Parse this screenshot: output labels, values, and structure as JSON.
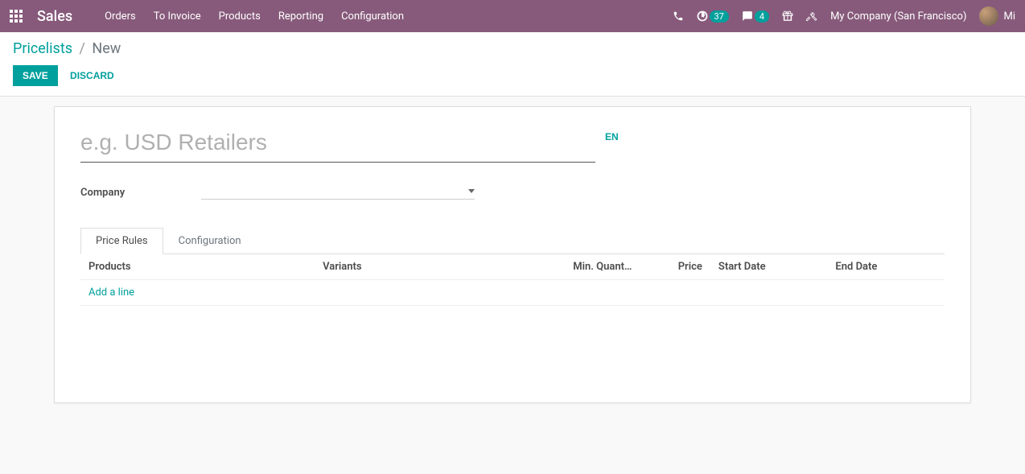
{
  "nav": {
    "brand": "Sales",
    "menu": [
      "Orders",
      "To Invoice",
      "Products",
      "Reporting",
      "Configuration"
    ],
    "activity_count": "37",
    "chat_count": "4",
    "company": "My Company (San Francisco)",
    "user_trunc": "Mi"
  },
  "breadcrumb": {
    "parent": "Pricelists",
    "current": "New"
  },
  "buttons": {
    "save": "SAVE",
    "discard": "DISCARD"
  },
  "form": {
    "title_placeholder": "e.g. USD Retailers",
    "lang_btn": "EN",
    "company_label": "Company",
    "company_value": ""
  },
  "tabs": [
    "Price Rules",
    "Configuration"
  ],
  "table": {
    "headers": {
      "products": "Products",
      "variants": "Variants",
      "min_qty": "Min. Quant…",
      "price": "Price",
      "start_date": "Start Date",
      "end_date": "End Date"
    },
    "add_line": "Add a line"
  }
}
